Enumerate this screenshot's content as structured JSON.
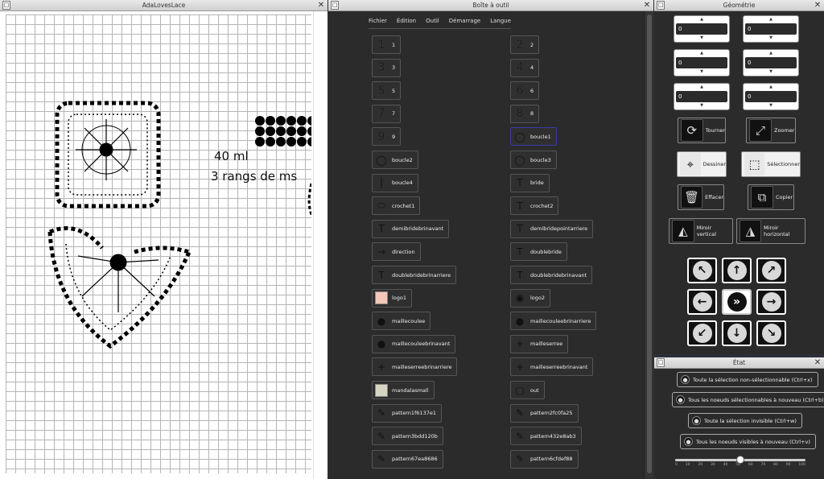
{
  "canvas_window": {
    "title": "AdaLovesLace",
    "text_line1": "40 ml",
    "text_line2": "3 rangs de ms"
  },
  "toolbox_window": {
    "title": "Boîte à outil",
    "menu": [
      "Fichier",
      "Édition",
      "Outil",
      "Démarrage",
      "Langue"
    ],
    "left_tools": [
      {
        "label": "1",
        "icon": "1"
      },
      {
        "label": "3",
        "icon": "3"
      },
      {
        "label": "5",
        "icon": "5"
      },
      {
        "label": "7",
        "icon": "7"
      },
      {
        "label": "9",
        "icon": "9"
      },
      {
        "label": "boucle2",
        "icon": "loop-icon"
      },
      {
        "label": "boucle4",
        "icon": "line-icon"
      },
      {
        "label": "crochet1",
        "icon": "oval-icon"
      },
      {
        "label": "demibridebrinavant",
        "icon": "T"
      },
      {
        "label": "direction",
        "icon": "arrow-icon"
      },
      {
        "label": "doublebridebrinarriere",
        "icon": "T"
      },
      {
        "label": "logo1",
        "icon": "swatch-icon"
      },
      {
        "label": "maillecoulee",
        "icon": "dot-icon"
      },
      {
        "label": "maillecouleebrinavant",
        "icon": "dot-icon"
      },
      {
        "label": "mailleserreebrinarriere",
        "icon": "plus-icon"
      },
      {
        "label": "mandalasmall",
        "icon": "swatch-icon"
      },
      {
        "label": "pattern1f6137e1",
        "icon": "pattern-icon"
      },
      {
        "label": "pattern3bdd120b",
        "icon": "pattern-icon"
      },
      {
        "label": "pattern67ea8686",
        "icon": "pattern-icon"
      }
    ],
    "right_tools": [
      {
        "label": "2",
        "icon": "2"
      },
      {
        "label": "4",
        "icon": "4"
      },
      {
        "label": "6",
        "icon": "6"
      },
      {
        "label": "8",
        "icon": "8"
      },
      {
        "label": "boucle1",
        "icon": "loop-icon",
        "selected": true
      },
      {
        "label": "boucle3",
        "icon": "loop-icon"
      },
      {
        "label": "bride",
        "icon": "T"
      },
      {
        "label": "crochet2",
        "icon": "T"
      },
      {
        "label": "demibridepointarriere",
        "icon": "T"
      },
      {
        "label": "doublebride",
        "icon": "T"
      },
      {
        "label": "doublebridebrinavant",
        "icon": "T"
      },
      {
        "label": "logo2",
        "icon": "logo-icon"
      },
      {
        "label": "maillecouleebrinarriere",
        "icon": "dot-icon"
      },
      {
        "label": "mailleserree",
        "icon": "plus-icon"
      },
      {
        "label": "mailleserreebrinavant",
        "icon": "plus-icon"
      },
      {
        "label": "out",
        "icon": "out-icon"
      },
      {
        "label": "pattern2fc0fa25",
        "icon": "pattern-icon"
      },
      {
        "label": "pattern432e8ab3",
        "icon": "pattern-icon"
      },
      {
        "label": "pattern6cfdef88",
        "icon": "pattern-icon"
      }
    ]
  },
  "geometry_window": {
    "title": "Géométrie",
    "spins": [
      "0",
      "0",
      "0",
      "0",
      "0",
      "0"
    ],
    "buttons": {
      "tourner": "Tourner",
      "zoomer": "Zoomer",
      "dessiner": "Dessiner",
      "selectionner": "Sélectionner",
      "effacer": "Effacer",
      "copier": "Copier",
      "miroir_vertical": "Miroir vertical",
      "miroir_horizontal": "Miroir horizontal"
    }
  },
  "etat_window": {
    "title": "État",
    "buttons": [
      "Toute la sélection non-sélectionnable (Ctrl+x)",
      "Tous les noeuds sélectionnables à nouveau (Ctrl+b)",
      "Toute la sélection invisible (Ctrl+w)",
      "Tous les noeuds visibles à nouveau (Ctrl+v)"
    ],
    "slider_value": 50,
    "slider_ticks": [
      "0",
      "10",
      "20",
      "30",
      "40",
      "50",
      "60",
      "70",
      "80",
      "90",
      "100"
    ]
  }
}
